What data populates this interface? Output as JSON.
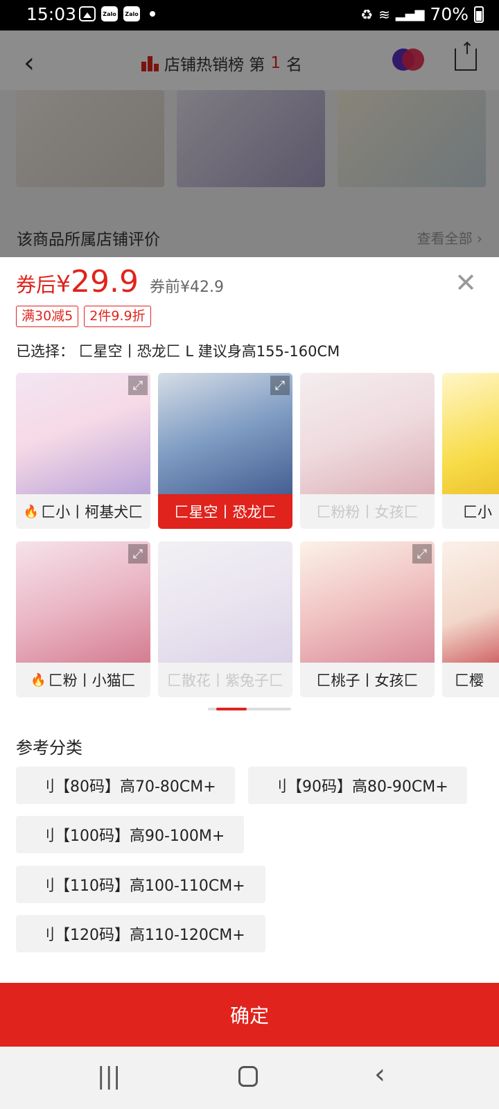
{
  "status": {
    "time": "15:03",
    "battery": "70%"
  },
  "background": {
    "header_title": "店铺热销榜 第",
    "rank": "1",
    "rank_suffix": "名",
    "review_title": "该商品所属店铺评价",
    "view_all": "查看全部"
  },
  "sheet": {
    "price_label": "券后",
    "currency": "¥",
    "price": "29.9",
    "old_price": "券前¥42.9",
    "tags": [
      "满30减5",
      "2件9.9折"
    ],
    "selected_text": "已选择： 匚星空丨恐龙匚 L 建议身高155-160CM",
    "variants": [
      {
        "label": "匚小丨柯基犬匚",
        "hot": true,
        "state": "normal"
      },
      {
        "label": "匚星空丨恐龙匚",
        "hot": false,
        "state": "selected"
      },
      {
        "label": "匚粉粉丨女孩匚",
        "hot": false,
        "state": "disabled"
      },
      {
        "label": "匚小",
        "hot": false,
        "state": "normal"
      },
      {
        "label": "匚粉丨小猫匚",
        "hot": true,
        "state": "normal"
      },
      {
        "label": "匚散花丨紫兔子匚",
        "hot": false,
        "state": "disabled"
      },
      {
        "label": "匚桃子丨女孩匚",
        "hot": false,
        "state": "normal"
      },
      {
        "label": "匚樱",
        "hot": false,
        "state": "normal"
      }
    ],
    "ref_title": "参考分类",
    "sizes": [
      "刂【80码】高70-80CM+",
      "刂【90码】高80-90CM+",
      "刂【100码】高90-100M+",
      "刂【110码】高100-110CM+",
      "刂【120码】高110-120CM+"
    ],
    "confirm": "确定"
  }
}
